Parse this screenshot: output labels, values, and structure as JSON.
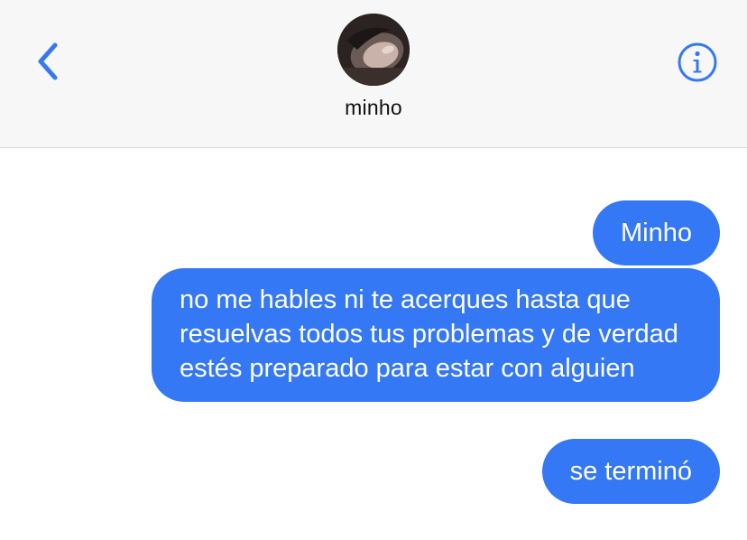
{
  "header": {
    "contact_name": "minho",
    "back_icon": "chevron-left-icon",
    "info_icon": "info-circle-icon",
    "accent_color": "#3478f6"
  },
  "messages": [
    {
      "direction": "outgoing",
      "text": "Minho"
    },
    {
      "direction": "outgoing",
      "text": "no me hables ni te acerques hasta que resuelvas todos tus problemas y de verdad estés preparado para estar con alguien"
    },
    {
      "direction": "outgoing",
      "text": "se terminó"
    }
  ],
  "colors": {
    "bubble_background": "#3478f6",
    "bubble_text": "#ffffff",
    "header_background": "#f7f7f7"
  }
}
